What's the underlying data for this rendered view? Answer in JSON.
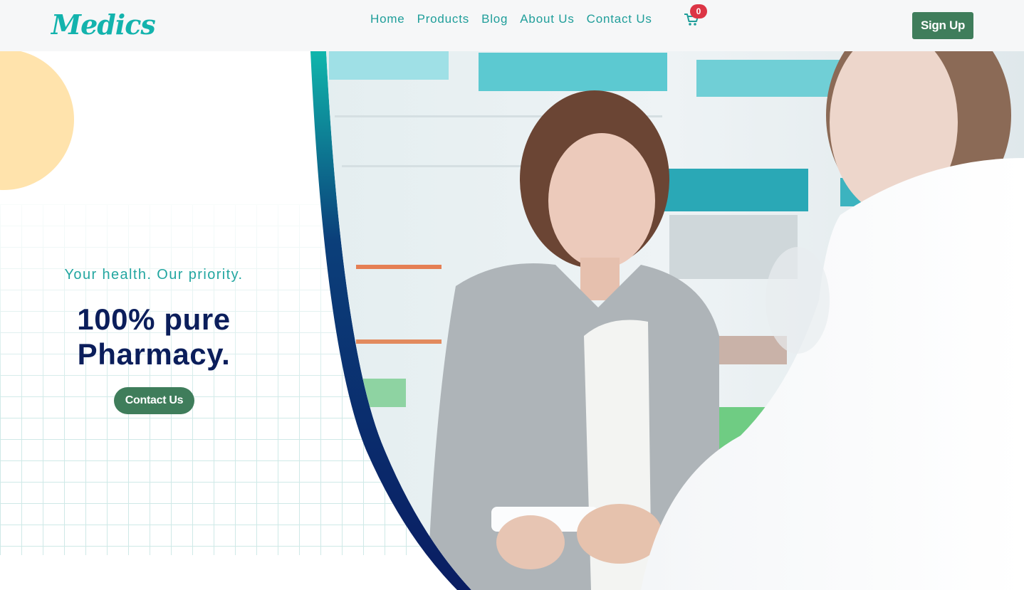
{
  "brand": {
    "name": "Medics"
  },
  "nav": {
    "items": [
      {
        "label": "Home"
      },
      {
        "label": "Products"
      },
      {
        "label": "Blog"
      },
      {
        "label": "About Us"
      },
      {
        "label": "Contact Us"
      }
    ],
    "cart_icon": "shopping-cart-icon",
    "cart_count": "0",
    "signup_label": "Sign Up"
  },
  "hero": {
    "tagline": "Your health. Our priority.",
    "headline_line1": "100% pure",
    "headline_line2": "Pharmacy.",
    "cta_label": "Contact Us",
    "image": "pharmacy-counter-photo"
  },
  "colors": {
    "accent": "#13b3ad",
    "navy": "#0b1e5b",
    "button_green": "#3f7d5b",
    "badge_red": "#dc3545",
    "peach": "#ffe3ac"
  }
}
